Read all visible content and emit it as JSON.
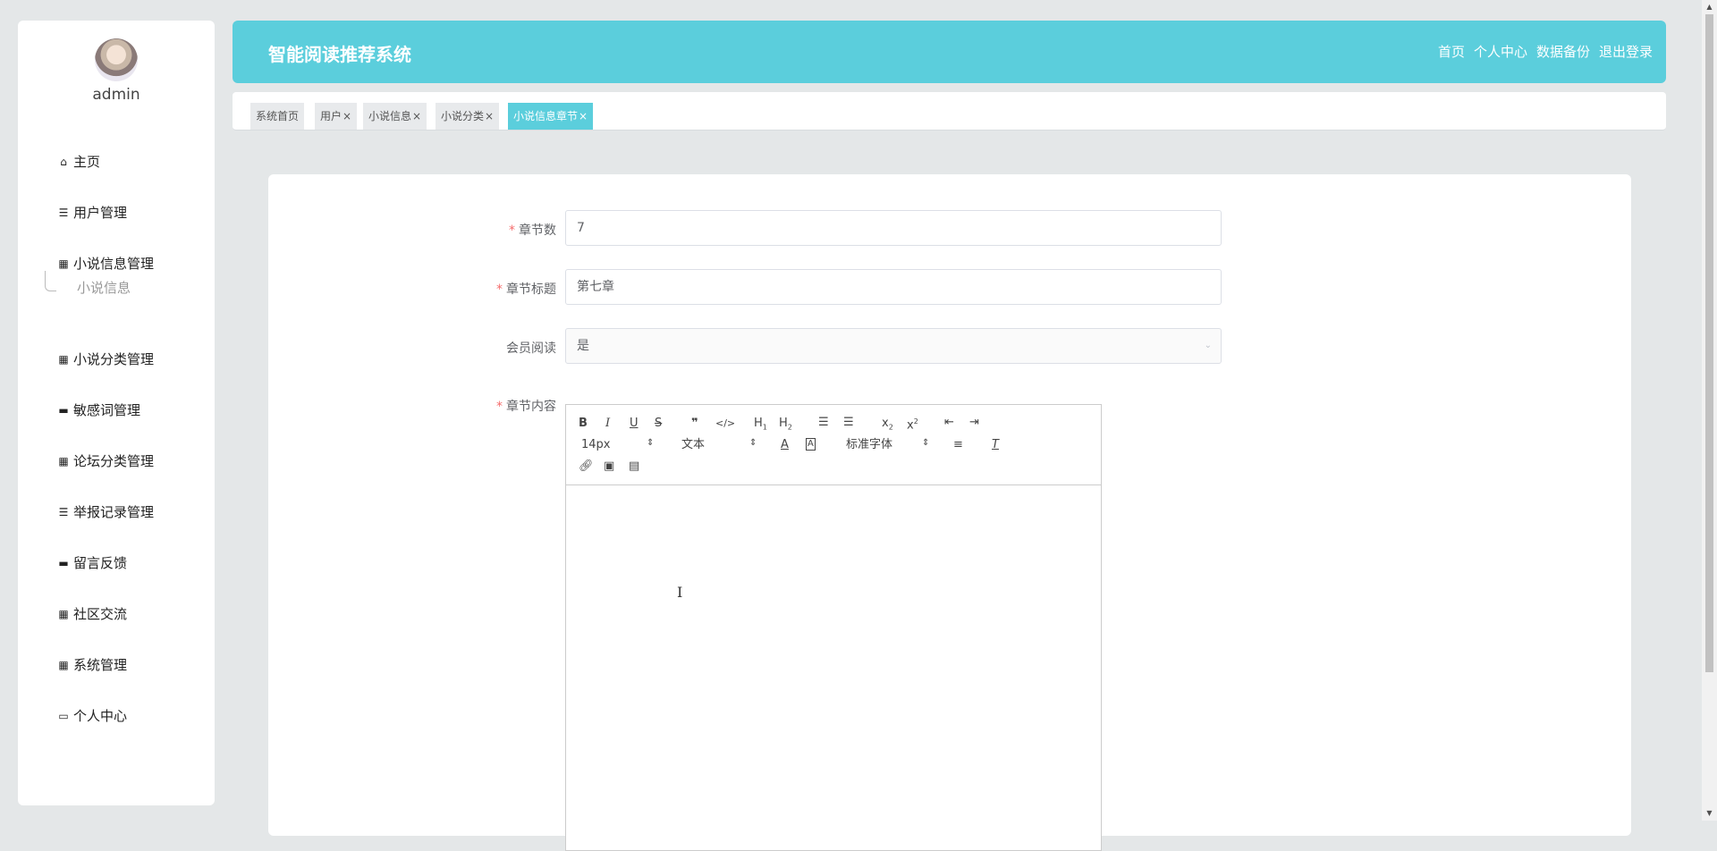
{
  "sidebar": {
    "username": "admin",
    "items": [
      {
        "icon": "home-icon",
        "glyph": "⌂",
        "label": "主页"
      },
      {
        "icon": "list-icon",
        "glyph": "☰",
        "label": "用户管理"
      },
      {
        "icon": "grid-icon",
        "glyph": "▦",
        "label": "小说信息管理"
      },
      {
        "icon": "grid-icon",
        "glyph": "▦",
        "label": "小说分类管理"
      },
      {
        "icon": "message-icon",
        "glyph": "▬",
        "label": "敏感词管理"
      },
      {
        "icon": "grid-icon",
        "glyph": "▦",
        "label": "论坛分类管理"
      },
      {
        "icon": "sliders-icon",
        "glyph": "☰",
        "label": "举报记录管理"
      },
      {
        "icon": "monitor-icon",
        "glyph": "▬",
        "label": "留言反馈"
      },
      {
        "icon": "grid-icon",
        "glyph": "▦",
        "label": "社区交流"
      },
      {
        "icon": "grid-icon",
        "glyph": "▦",
        "label": "系统管理"
      },
      {
        "icon": "card-icon",
        "glyph": "▭",
        "label": "个人中心"
      }
    ],
    "subitem": "小说信息"
  },
  "header": {
    "title": "智能阅读推荐系统",
    "links": [
      "首页",
      "个人中心",
      "数据备份",
      "退出登录"
    ],
    "accent": "#5bcedc"
  },
  "tabs": [
    {
      "label": "系统首页",
      "closable": false
    },
    {
      "label": "用户",
      "closable": true
    },
    {
      "label": "小说信息",
      "closable": true
    },
    {
      "label": "小说分类",
      "closable": true
    },
    {
      "label": "小说信息章节",
      "closable": true,
      "active": true
    }
  ],
  "form": {
    "chapter_num": {
      "label": "章节数",
      "required": true,
      "value": "7"
    },
    "chapter_title": {
      "label": "章节标题",
      "required": true,
      "value": "第七章"
    },
    "member_read": {
      "label": "会员阅读",
      "required": false,
      "value": "是"
    },
    "chapter_content": {
      "label": "章节内容",
      "required": true
    }
  },
  "editor": {
    "font_size": "14px",
    "header": "文本",
    "font_family": "标准字体",
    "cursor": "I"
  },
  "tab_close_glyph": "×",
  "required_mark": "*"
}
